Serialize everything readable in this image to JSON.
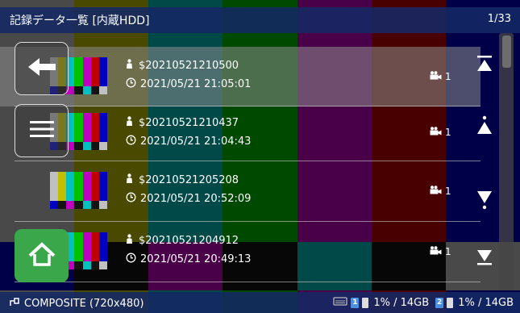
{
  "header": {
    "title": "記録データ一覧 [内蔵HDD]",
    "page_count": "1/33"
  },
  "records": [
    {
      "name": "$20210521210500",
      "datetime": "2021/05/21 21:05:01",
      "camera_count": "1",
      "selected": true
    },
    {
      "name": "$20210521210437",
      "datetime": "2021/05/21 21:04:43",
      "camera_count": "1",
      "selected": false
    },
    {
      "name": "$20210521205208",
      "datetime": "2021/05/21 20:52:09",
      "camera_count": "1",
      "selected": false
    },
    {
      "name": "$20210521204912",
      "datetime": "2021/05/21 20:49:13",
      "camera_count": "1",
      "selected": false
    }
  ],
  "side_buttons": {
    "back": "back-arrow-icon",
    "menu": "menu-icon",
    "home": "home-icon"
  },
  "scroll_buttons": [
    "scroll-top-icon",
    "scroll-page-up-icon",
    "scroll-page-down-icon",
    "scroll-bottom-icon"
  ],
  "footer": {
    "source": "COMPOSITE (720x480)",
    "slot1_label": "1",
    "slot1_usage": "1% / 14GB",
    "slot2_label": "2",
    "slot2_usage": "1% / 14GB"
  },
  "colors": {
    "header_bg": "#142864",
    "home_button": "#3aa84a",
    "slot_badge": "#4a8fe0"
  }
}
